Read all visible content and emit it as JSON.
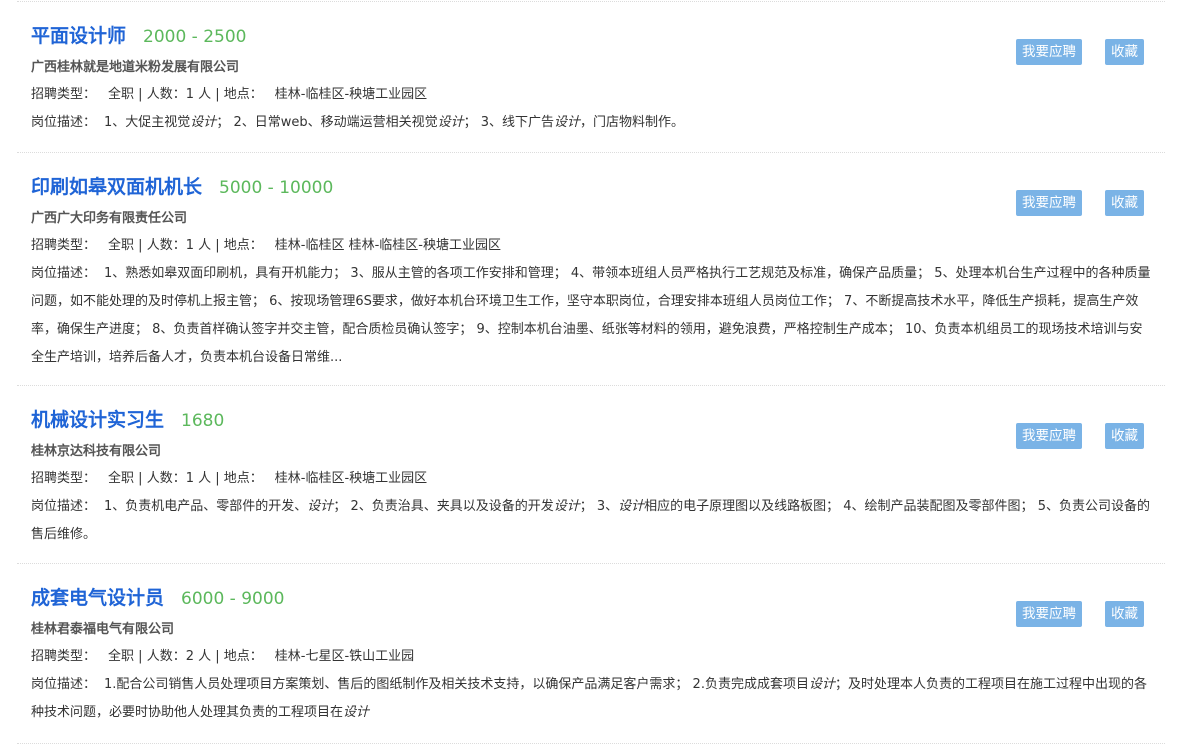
{
  "labels": {
    "type_label": "招聘类型：",
    "count_label": "人数：",
    "location_label": "地点：",
    "desc_label": "岗位描述：",
    "apply_button": "我要应聘",
    "favorite_button": "收藏"
  },
  "jobs": [
    {
      "title": "平面设计师",
      "salary": "2000 - 2500",
      "company": "广西桂林就是地道米粉发展有限公司",
      "type": "全职",
      "count": "1 人",
      "location": "桂林-临桂区-秧塘工业园区",
      "desc": [
        {
          "t": "1、大促主视觉"
        },
        {
          "t": "设计",
          "em": true
        },
        {
          "t": "； 2、日常web、移动端运营相关视觉"
        },
        {
          "t": "设计",
          "em": true
        },
        {
          "t": "； 3、线下广告"
        },
        {
          "t": "设计",
          "em": true
        },
        {
          "t": "，门店物料制作。"
        }
      ]
    },
    {
      "title": "印刷如皋双面机机长",
      "salary": "5000 - 10000",
      "company": "广西广大印务有限责任公司",
      "type": "全职",
      "count": "1 人",
      "location": "桂林-临桂区 桂林-临桂区-秧塘工业园区",
      "desc": [
        {
          "t": "1、熟悉如皋双面印刷机，具有开机能力； 3、服从主管的各项工作安排和管理； 4、带领本班组人员严格执行工艺规范及标准，确保产品质量； 5、处理本机台生产过程中的各种质量问题，如不能处理的及时停机上报主管； 6、按现场管理6S要求，做好本机台环境卫生工作，坚守本职岗位，合理安排本班组人员岗位工作； 7、不断提高技术水平，降低生产损耗，提高生产效率，确保生产进度； 8、负责首样确认签字并交主管，配合质检员确认签字； 9、控制本机台油墨、纸张等材料的领用，避免浪费，严格控制生产成本； 10、负责本机组员工的现场技术培训与安全生产培训，培养后备人才，负责本机台设备日常维..."
        }
      ]
    },
    {
      "title": "机械设计实习生",
      "salary": "1680",
      "company": "桂林京达科技有限公司",
      "type": "全职",
      "count": "1 人",
      "location": "桂林-临桂区-秧塘工业园区",
      "desc": [
        {
          "t": "1、负责机电产品、零部件的开发、"
        },
        {
          "t": "设计",
          "em": true
        },
        {
          "t": "； 2、负责治具、夹具以及设备的开发"
        },
        {
          "t": "设计",
          "em": true
        },
        {
          "t": "； 3、"
        },
        {
          "t": "设计",
          "em": true
        },
        {
          "t": "相应的电子原理图以及线路板图； 4、绘制产品装配图及零部件图； 5、负责公司设备的售后维修。"
        }
      ]
    },
    {
      "title": "成套电气设计员",
      "salary": "6000 - 9000",
      "company": "桂林君泰福电气有限公司",
      "type": "全职",
      "count": "2 人",
      "location": "桂林-七星区-铁山工业园",
      "desc": [
        {
          "t": "1.配合公司销售人员处理项目方案策划、售后的图纸制作及相关技术支持，以确保产品满足客户需求； 2.负责完成成套项目"
        },
        {
          "t": "设计",
          "em": true
        },
        {
          "t": "；及时处理本人负责的工程项目在施工过程中出现的各种技术问题，必要时协助他人处理其负责的工程项目在"
        },
        {
          "t": "设计",
          "em": true
        }
      ]
    }
  ]
}
